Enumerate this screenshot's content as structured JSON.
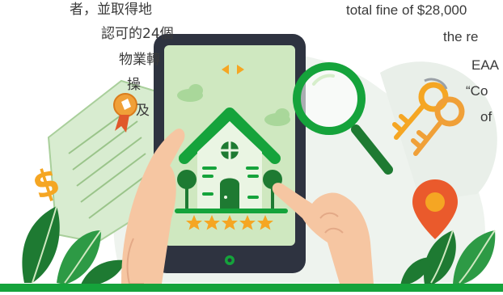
{
  "left_text": [
    "者，並取得地",
    "認可的24個",
    "物業轉",
    "操",
    "及"
  ],
  "right_text": [
    "total fine of $28,000",
    "the re",
    "EAA",
    "“Co",
    "of"
  ],
  "colors": {
    "accent_green": "#15a33b",
    "dark_green": "#1e7a32",
    "light_green": "#cfe8c0",
    "tablet_frame": "#2e3340",
    "key_orange": "#f5a623",
    "pin_red": "#ea5a2c",
    "skin": "#f6c6a2",
    "cloud_gray": "#e8efe8"
  },
  "icons": [
    "house-icon",
    "magnifier-icon",
    "keys-icon",
    "location-pin-icon",
    "dollar-icon",
    "certificate-icon",
    "star-icon",
    "arrow-left-icon",
    "arrow-right-icon"
  ],
  "rating_stars": 5
}
